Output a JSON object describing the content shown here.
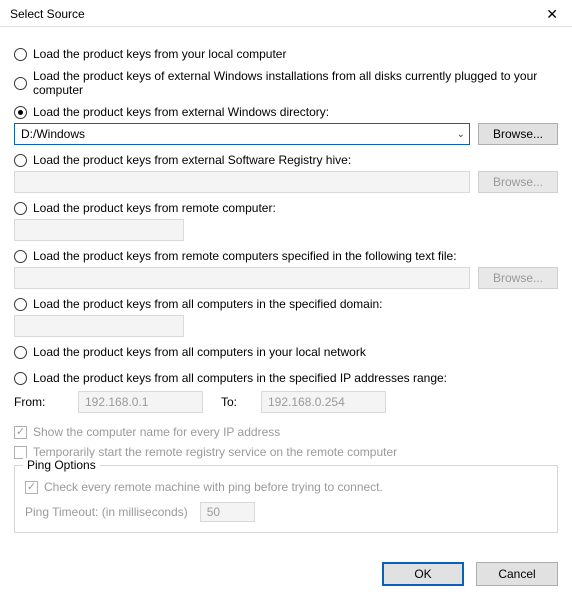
{
  "window": {
    "title": "Select Source"
  },
  "options": {
    "local": "Load the product keys from your local computer",
    "all_disks": "Load the product keys of external Windows installations from all disks currently plugged to your computer",
    "ext_dir": "Load the product keys from external Windows directory:",
    "ext_dir_value": "D:/Windows",
    "reg_hive": "Load the product keys from external Software Registry hive:",
    "remote_comp": "Load the product keys from remote computer:",
    "remote_file": "Load the product keys from remote computers specified in the following text file:",
    "domain": "Load the product keys from all computers in the specified domain:",
    "local_net": "Load the product keys from all computers in your local network",
    "ip_range": "Load the product keys from all computers in the specified IP addresses range:"
  },
  "ip": {
    "from_label": "From:",
    "from_value": "192.168.0.1",
    "to_label": "To:",
    "to_value": "192.168.0.254"
  },
  "checks": {
    "show_name": "Show the computer name for every IP address",
    "temp_reg": "Temporarily start the remote registry service on the remote computer"
  },
  "ping": {
    "legend": "Ping Options",
    "check": "Check every remote machine with ping before trying to connect.",
    "timeout_label": "Ping Timeout: (in milliseconds)",
    "timeout_value": "50"
  },
  "buttons": {
    "browse": "Browse...",
    "ok": "OK",
    "cancel": "Cancel"
  }
}
